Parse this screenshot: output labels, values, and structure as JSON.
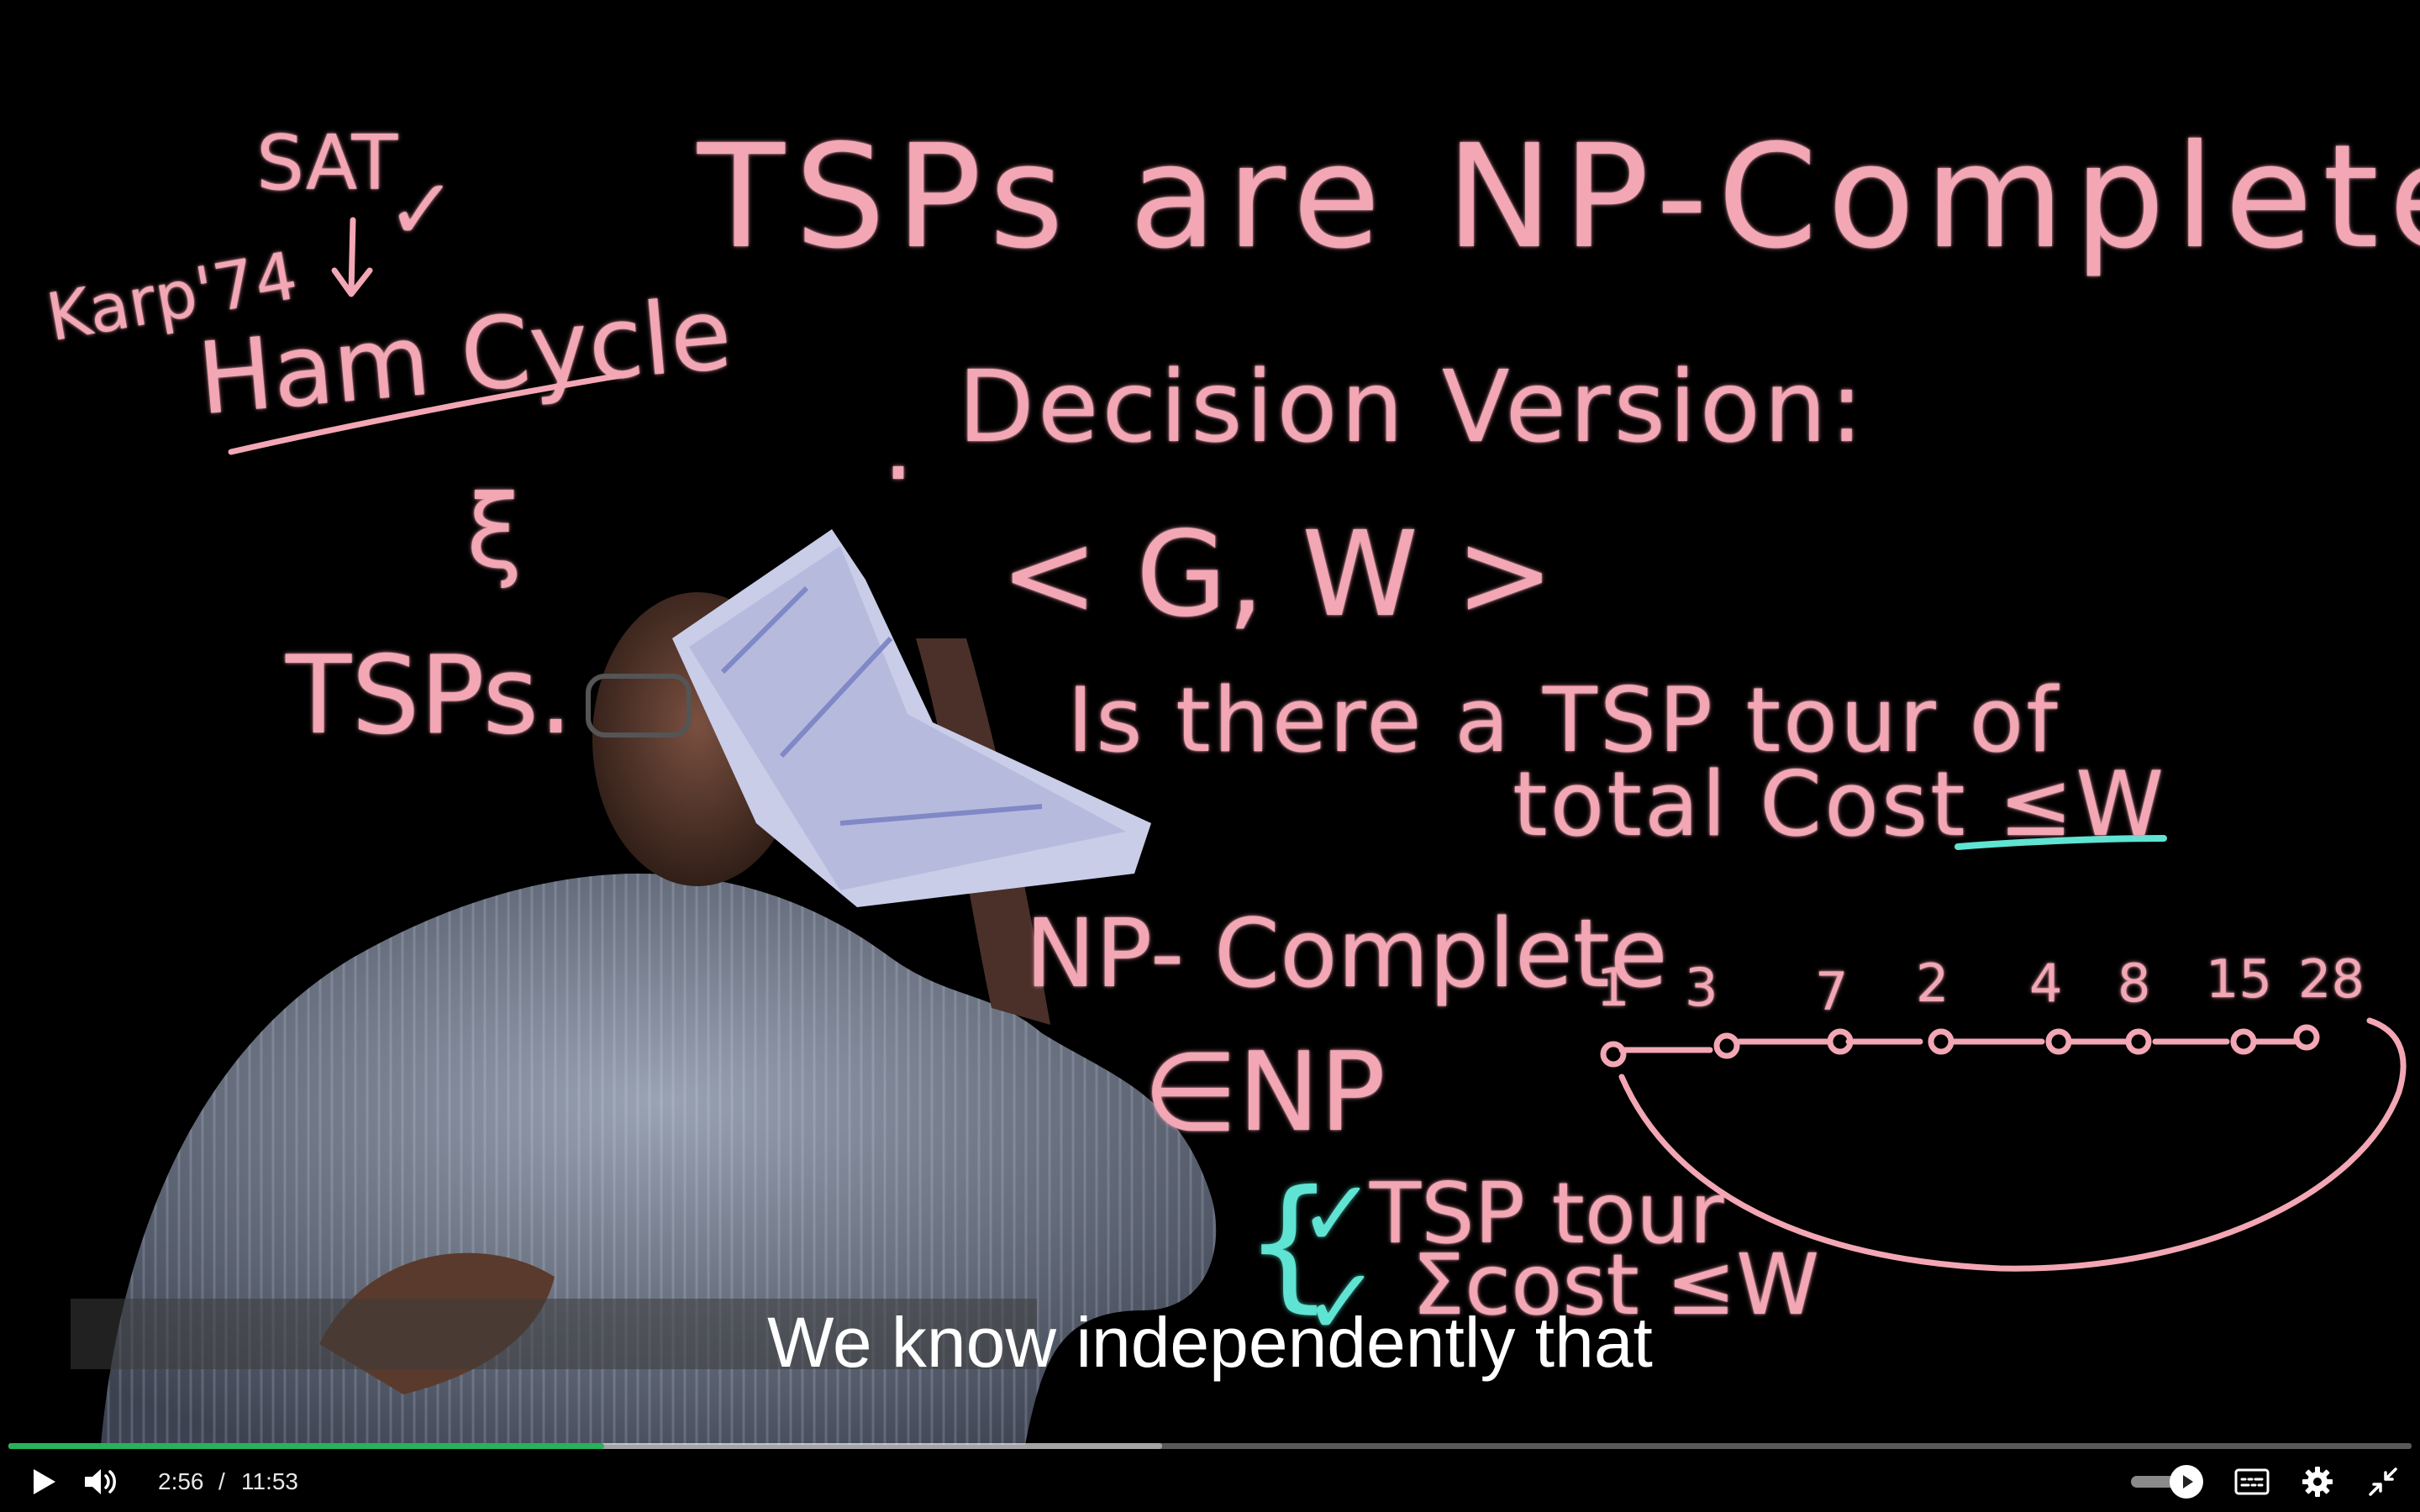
{
  "board": {
    "title": "TSPs are NP-Complete",
    "side_top": "SAT",
    "side_karp": "Karp'74",
    "side_ham": "Ham Cycle",
    "side_brace": "ξ",
    "side_tsps": "TSPs.",
    "bullet": ".",
    "decision": "Decision Version:",
    "instance": "< G, W >",
    "question_line1": "Is there a TSP tour of",
    "question_line2": "total Cost ≤W",
    "np_complete": "NP- Complete",
    "in_np": "∈NP",
    "check1": "✓",
    "check2": "✓",
    "brace": "{",
    "tsp_tour": "TSP tour",
    "cost_le_w": "Σcost ≤W",
    "node_labels": [
      "1",
      "3",
      "7",
      "2",
      "4",
      "8",
      "15",
      "28"
    ]
  },
  "caption": "We know independently that",
  "player": {
    "current_time": "2:56",
    "separator": "/",
    "duration": "11:53",
    "progress_fraction": 0.248,
    "buffered_fraction": 0.48,
    "accent_color": "#26b35a",
    "icons": [
      "play-icon",
      "volume-icon",
      "hd-toggle-icon",
      "captions-icon",
      "settings-icon",
      "exit-fullscreen-icon"
    ]
  }
}
